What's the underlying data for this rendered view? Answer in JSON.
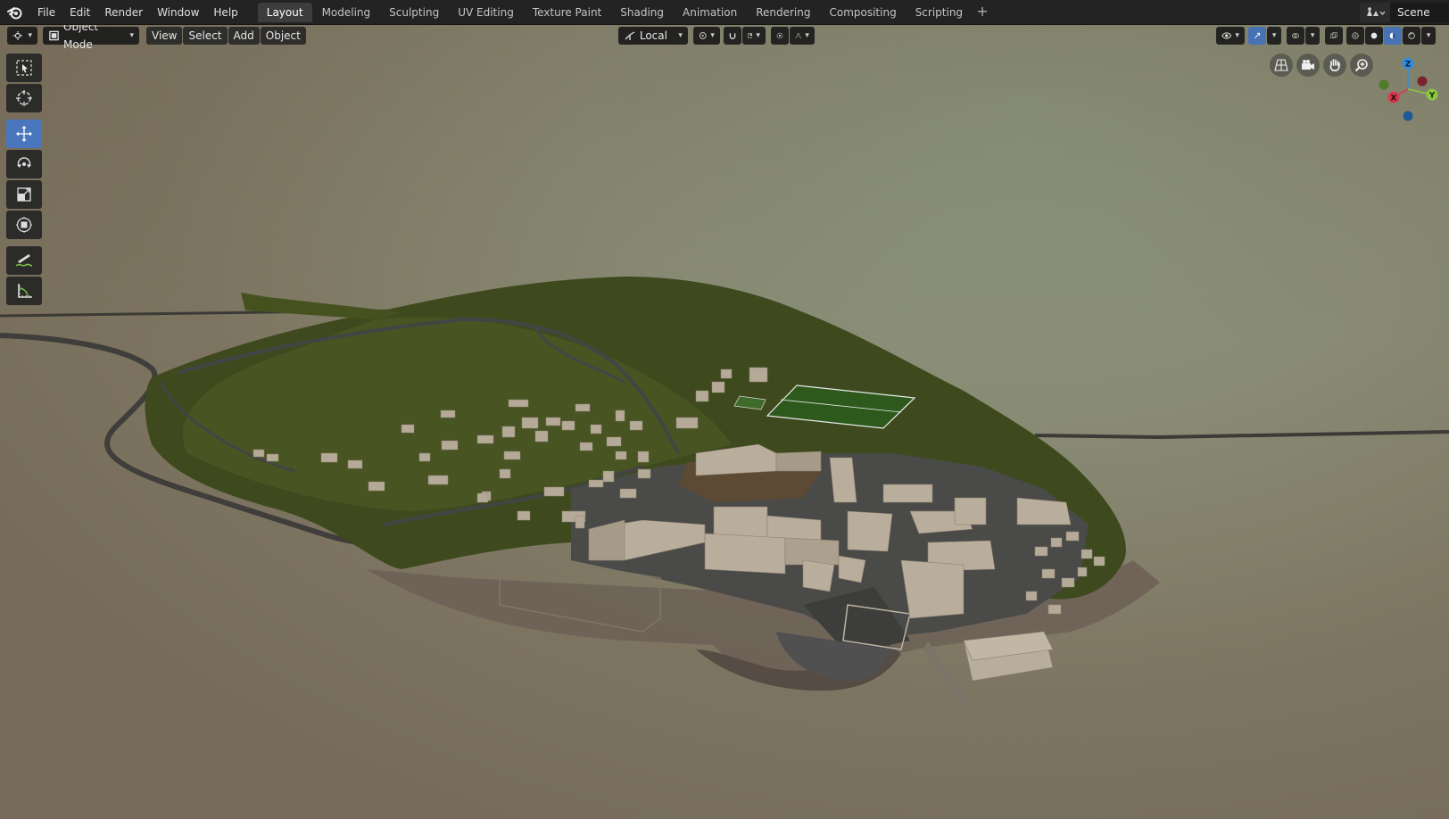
{
  "topbar": {
    "menus": [
      "File",
      "Edit",
      "Render",
      "Window",
      "Help"
    ],
    "workspaces": [
      "Layout",
      "Modeling",
      "Sculpting",
      "UV Editing",
      "Texture Paint",
      "Shading",
      "Animation",
      "Rendering",
      "Compositing",
      "Scripting"
    ],
    "active_workspace": "Layout",
    "add_tab": "+",
    "scene_name": "Scene"
  },
  "viewport_header": {
    "mode": "Object Mode",
    "view_menu": "View",
    "select_menu": "Select",
    "add_menu": "Add",
    "object_menu": "Object",
    "transform_orientation": "Local"
  },
  "toolbar": {
    "tools": [
      "select-box",
      "cursor",
      "move",
      "rotate",
      "scale",
      "transform",
      "annotate",
      "measure"
    ],
    "active_tool": "move"
  },
  "gizmo": {
    "axes": {
      "x": "X",
      "y": "Y",
      "z": "Z"
    },
    "colors": {
      "x": "#d63a4a",
      "y": "#8cc63f",
      "z": "#2e8fe0",
      "neg_x": "#7a2230",
      "neg_y": "#4f7a26",
      "neg_z": "#1f5a96"
    }
  },
  "colors": {
    "accent": "#4772b3",
    "terrain": "#3d4a1e",
    "building": "#b5aa98",
    "road": "#4a4a4a"
  }
}
